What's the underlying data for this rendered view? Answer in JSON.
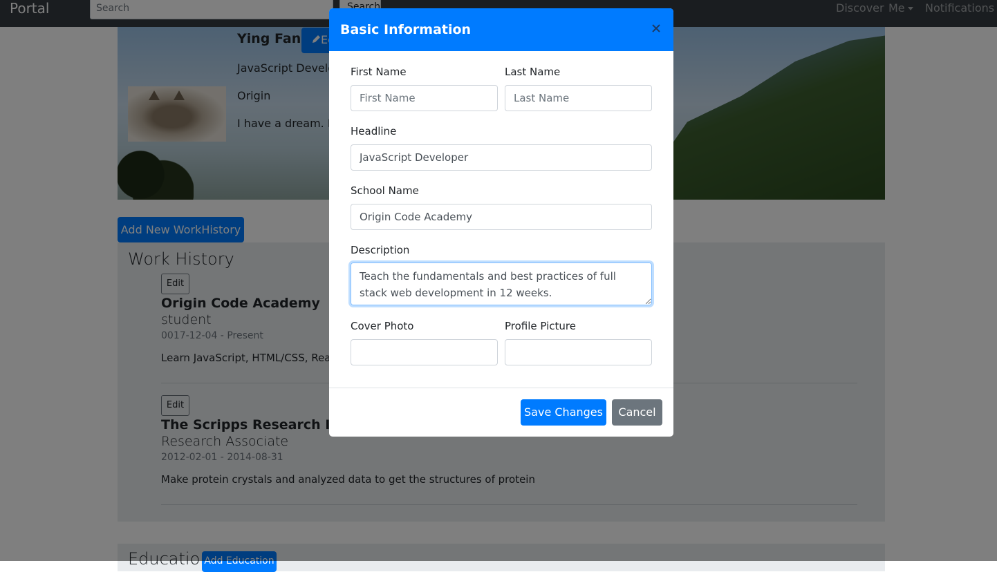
{
  "navbar": {
    "brand": "Portal",
    "search_placeholder": "Search",
    "search_button": "Search",
    "links": {
      "discover": "Discover",
      "me": "Me",
      "notifications": "Notifications"
    }
  },
  "profile": {
    "name": "Ying Fan",
    "edit_button": "Ed",
    "headline": "JavaScript Develop",
    "school": "Origin",
    "description": "I have a dream. In t"
  },
  "work": {
    "add_button": "Add New WorkHistory",
    "heading": "Work History",
    "edit_label": "Edit",
    "items": [
      {
        "company": "Origin Code Academy",
        "title": "student",
        "dates": "0017-12-04 - Present",
        "description": "Learn JavaScript, HTML/CSS, React,"
      },
      {
        "company": "The Scripps Research Instit",
        "title": "Research Associate",
        "dates": "2012-02-01 - 2014-08-31",
        "description": "Make protein crystals and analyzed data to get the structures of protein"
      }
    ]
  },
  "education": {
    "heading": "Education",
    "add_button": "Add Education"
  },
  "modal": {
    "title": "Basic Information",
    "labels": {
      "first_name": "First Name",
      "last_name": "Last Name",
      "headline": "Headline",
      "school_name": "School Name",
      "description": "Description",
      "cover_photo": "Cover Photo",
      "profile_picture": "Profile Picture"
    },
    "placeholders": {
      "first_name": "First Name",
      "last_name": "Last Name"
    },
    "values": {
      "first_name": "",
      "last_name": "",
      "headline": "JavaScript Developer",
      "school_name": "Origin Code Academy",
      "description": "Teach the fundamentals and best practices of full stack web development in 12 weeks.",
      "cover_photo": "",
      "profile_picture": ""
    },
    "buttons": {
      "save": "Save Changes",
      "cancel": "Cancel"
    }
  },
  "colors": {
    "primary": "#007bff",
    "secondary": "#6c757d",
    "navbar": "#343a40",
    "section_bg": "#e9ecef"
  }
}
